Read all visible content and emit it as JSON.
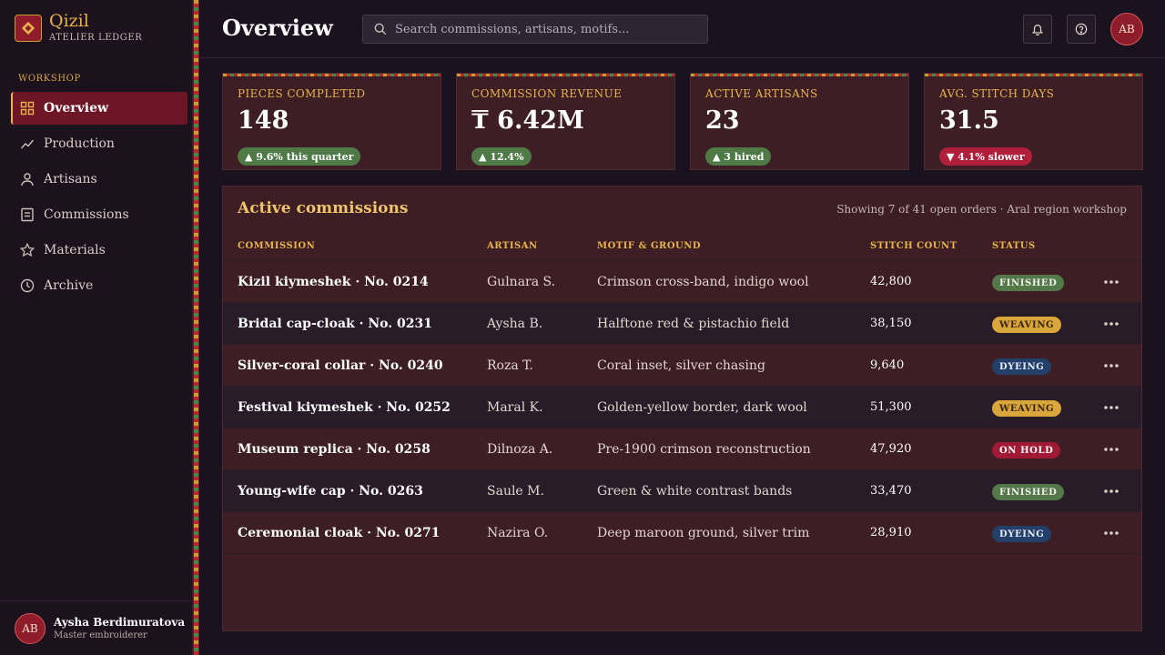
{
  "brand": {
    "name": "Qizil",
    "subtitle": "ATELIER LEDGER"
  },
  "sidebar": {
    "section_label": "WORKSHOP",
    "items": [
      {
        "label": "Overview",
        "icon": "grid-icon",
        "active": true
      },
      {
        "label": "Production",
        "icon": "trend-line-icon"
      },
      {
        "label": "Artisans",
        "icon": "person-icon"
      },
      {
        "label": "Commissions",
        "icon": "document-icon"
      },
      {
        "label": "Materials",
        "icon": "star-icon"
      },
      {
        "label": "Archive",
        "icon": "clock-icon"
      }
    ]
  },
  "user": {
    "initials": "AB",
    "name": "Aysha Berdimuratova",
    "role": "Master embroiderer"
  },
  "header": {
    "title": "Overview",
    "search_placeholder": "Search commissions, artisans, motifs...",
    "avatar_initials": "AB"
  },
  "stats": [
    {
      "label": "PIECES COMPLETED",
      "value": "148",
      "delta": "▲ 9.6% this quarter",
      "trend": "up"
    },
    {
      "label": "COMMISSION REVENUE",
      "value": "₸ 6.42M",
      "delta": "▲ 12.4%",
      "trend": "up"
    },
    {
      "label": "ACTIVE ARTISANS",
      "value": "23",
      "delta": "▲ 3 hired",
      "trend": "up"
    },
    {
      "label": "AVG. STITCH DAYS",
      "value": "31.5",
      "delta": "▼ 4.1% slower",
      "trend": "down"
    }
  ],
  "table": {
    "title": "Active commissions",
    "meta": "Showing 7 of 41 open orders · Aral region workshop",
    "columns": [
      "COMMISSION",
      "ARTISAN",
      "MOTIF & GROUND",
      "STITCH COUNT",
      "STATUS"
    ],
    "rows": [
      {
        "commission": "Kizil kiymeshek · No. 0214",
        "artisan": "Gulnara S.",
        "motif": "Crimson cross-band, indigo wool",
        "stitches": "42,800",
        "status": "FINISHED"
      },
      {
        "commission": "Bridal cap-cloak · No. 0231",
        "artisan": "Aysha B.",
        "motif": "Halftone red & pistachio field",
        "stitches": "38,150",
        "status": "WEAVING"
      },
      {
        "commission": "Silver-coral collar · No. 0240",
        "artisan": "Roza T.",
        "motif": "Coral inset, silver chasing",
        "stitches": "9,640",
        "status": "DYEING"
      },
      {
        "commission": "Festival kiymeshek · No. 0252",
        "artisan": "Maral K.",
        "motif": "Golden-yellow border, dark wool",
        "stitches": "51,300",
        "status": "WEAVING"
      },
      {
        "commission": "Museum replica · No. 0258",
        "artisan": "Dilnoza A.",
        "motif": "Pre-1900 crimson reconstruction",
        "stitches": "47,920",
        "status": "ON HOLD"
      },
      {
        "commission": "Young-wife cap · No. 0263",
        "artisan": "Saule M.",
        "motif": "Green & white contrast bands",
        "stitches": "33,470",
        "status": "FINISHED"
      },
      {
        "commission": "Ceremonial cloak · No. 0271",
        "artisan": "Nazira O.",
        "motif": "Deep maroon ground, silver trim",
        "stitches": "28,910",
        "status": "DYEING"
      }
    ]
  },
  "colors": {
    "accent_gold": "#e8b44a",
    "crimson": "#8e1c2b",
    "finished": "#54784a",
    "weaving": "#d8a63a",
    "dyeing": "#243f6a",
    "on_hold": "#a01a35"
  }
}
